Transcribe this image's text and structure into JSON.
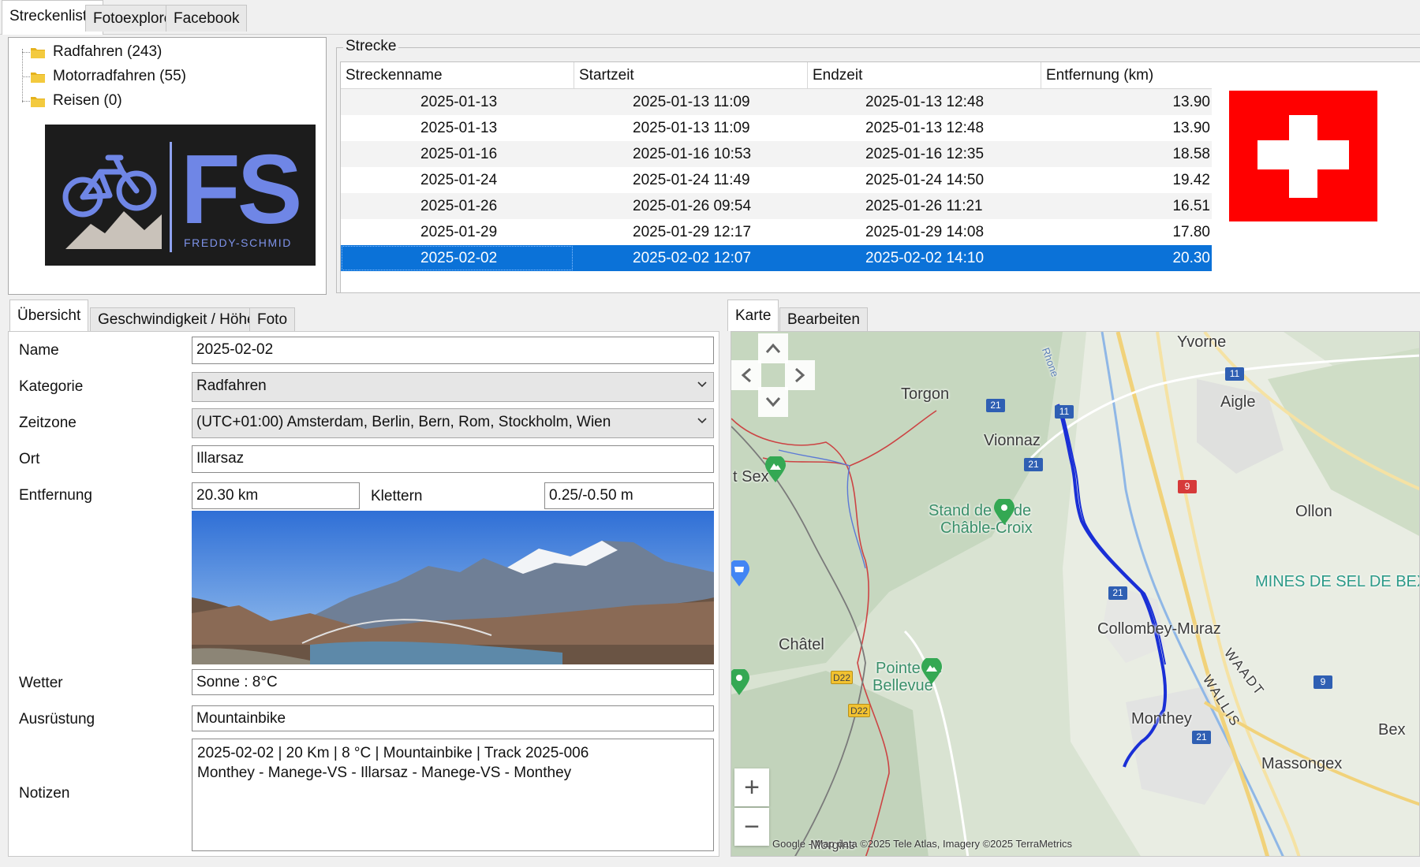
{
  "top_tabs": [
    "Streckenliste",
    "Fotoexplorer",
    "Facebook"
  ],
  "tree": {
    "items": [
      "Radfahren (243)",
      "Motorradfahren (55)",
      "Reisen (0)"
    ]
  },
  "logo": {
    "initials": "FS",
    "subtitle": "FREDDY-SCHMID"
  },
  "strecke": {
    "group_title": "Strecke",
    "columns": [
      "Streckenname",
      "Startzeit",
      "Endzeit",
      "Entfernung (km)"
    ],
    "rows": [
      [
        "2025-01-13",
        "2025-01-13 11:09",
        "2025-01-13 12:48",
        "13.90"
      ],
      [
        "2025-01-13",
        "2025-01-13 11:09",
        "2025-01-13 12:48",
        "13.90"
      ],
      [
        "2025-01-16",
        "2025-01-16 10:53",
        "2025-01-16 12:35",
        "18.58"
      ],
      [
        "2025-01-24",
        "2025-01-24 11:49",
        "2025-01-24 14:50",
        "19.42"
      ],
      [
        "2025-01-26",
        "2025-01-26 09:54",
        "2025-01-26 11:21",
        "16.51"
      ],
      [
        "2025-01-29",
        "2025-01-29 12:17",
        "2025-01-29 14:08",
        "17.80"
      ],
      [
        "2025-02-02",
        "2025-02-02 12:07",
        "2025-02-02 14:10",
        "20.30"
      ]
    ],
    "selected_index": 6
  },
  "detail_tabs": [
    "Übersicht",
    "Geschwindigkeit / Höhe",
    "Foto"
  ],
  "form": {
    "labels": {
      "name": "Name",
      "kategorie": "Kategorie",
      "zeitzone": "Zeitzone",
      "ort": "Ort",
      "entfernung": "Entfernung",
      "klettern": "Klettern",
      "wetter": "Wetter",
      "ausruestung": "Ausrüstung",
      "notizen": "Notizen"
    },
    "values": {
      "name": "2025-02-02",
      "kategorie": "Radfahren",
      "zeitzone": "(UTC+01:00) Amsterdam, Berlin, Bern, Rom, Stockholm, Wien",
      "ort": "Illarsaz",
      "entfernung": "20.30 km",
      "klettern": "0.25/-0.50 m",
      "wetter": "Sonne  :  8°C",
      "ausruestung": "Mountainbike",
      "notizen_line1": "2025-02-02  |  20 Km  |  8 °C  |  Mountainbike  |  Track 2025-006",
      "notizen_line2": "Monthey - Manege-VS - Illarsaz - Manege-VS - Monthey"
    }
  },
  "map_tabs": [
    "Karte",
    "Bearbeiten"
  ],
  "map": {
    "places": [
      "Yvorne",
      "Aigle",
      "Torgon",
      "Vionnaz",
      "t Sex",
      "Stand de tir de",
      "Châble-Croix",
      "Ollon",
      "MINES DE SEL DE BEX",
      "Collombey-Muraz",
      "WAADT",
      "WALLIS",
      "Châtel",
      "Pointe de",
      "Bellevue",
      "Monthey",
      "Bex",
      "Massongex",
      "Morgins",
      "Rhone"
    ],
    "road_numbers": [
      "11",
      "21",
      "11",
      "21",
      "9",
      "21",
      "21",
      "9",
      "D22",
      "D22"
    ],
    "copyright": "Google - Map data ©2025 Tele Atlas, Imagery ©2025 TerraMetrics",
    "colors": {
      "track": "#1a2fd6",
      "border": "#c0392b",
      "land": "#d9e3d2"
    }
  },
  "colors": {
    "selection": "#0b72d8",
    "flag_red": "#ff0000",
    "logo_blue": "#6f86e6"
  }
}
